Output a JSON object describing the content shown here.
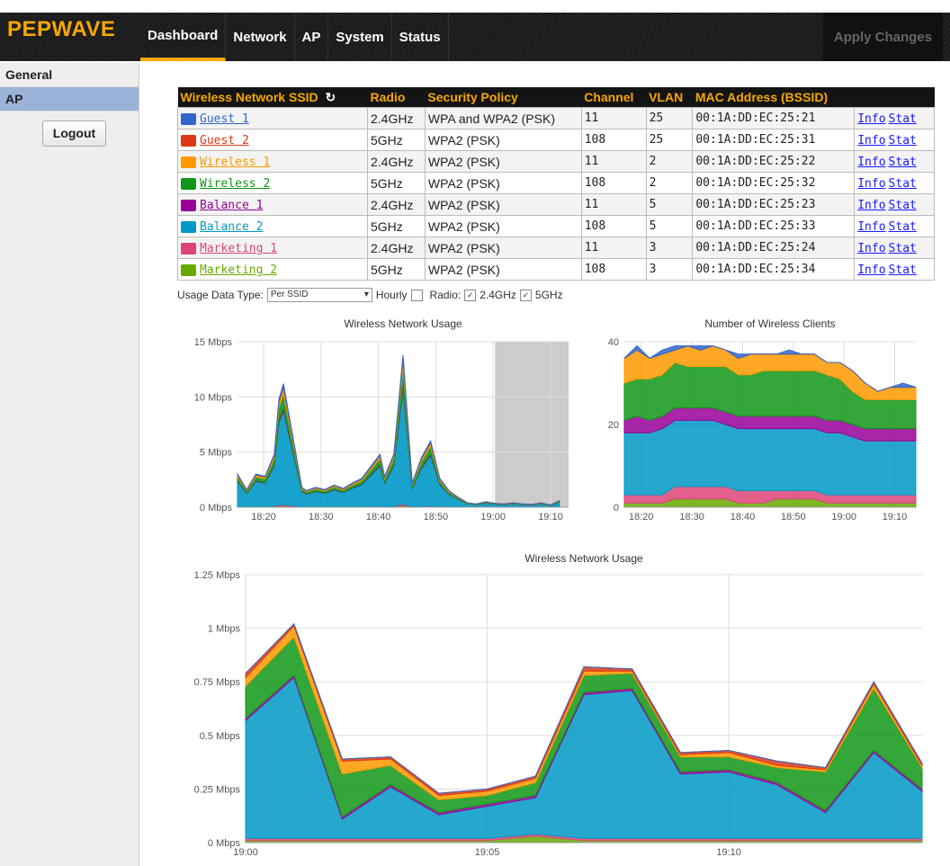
{
  "header": {
    "logo": "PEPWAVE",
    "tabs": [
      {
        "label": "Dashboard"
      },
      {
        "label": "Network"
      },
      {
        "label": "AP"
      },
      {
        "label": "System"
      },
      {
        "label": "Status"
      }
    ],
    "apply_label": "Apply Changes",
    "accent_color": "#f6a800"
  },
  "sidebar": {
    "items": [
      {
        "label": "General"
      },
      {
        "label": "AP"
      }
    ],
    "logout_label": "Logout"
  },
  "table": {
    "headers": {
      "ssid": "Wireless Network SSID",
      "radio": "Radio",
      "security": "Security Policy",
      "channel": "Channel",
      "vlan": "VLAN",
      "mac": "MAC Address (BSSID)"
    },
    "rows": [
      {
        "ssid": "Guest 1",
        "color": "#3366cc",
        "radio": "2.4GHz",
        "security": "WPA and WPA2 (PSK)",
        "channel": "11",
        "vlan": "25",
        "mac": "00:1A:DD:EC:25:21"
      },
      {
        "ssid": "Guest 2",
        "color": "#dc3912",
        "radio": "5GHz",
        "security": "WPA2 (PSK)",
        "channel": "108",
        "vlan": "25",
        "mac": "00:1A:DD:EC:25:31"
      },
      {
        "ssid": "Wireless 1",
        "color": "#ff9900",
        "radio": "2.4GHz",
        "security": "WPA2 (PSK)",
        "channel": "11",
        "vlan": "2",
        "mac": "00:1A:DD:EC:25:22"
      },
      {
        "ssid": "Wireless 2",
        "color": "#109618",
        "radio": "5GHz",
        "security": "WPA2 (PSK)",
        "channel": "108",
        "vlan": "2",
        "mac": "00:1A:DD:EC:25:32"
      },
      {
        "ssid": "Balance 1",
        "color": "#990099",
        "radio": "2.4GHz",
        "security": "WPA2 (PSK)",
        "channel": "11",
        "vlan": "5",
        "mac": "00:1A:DD:EC:25:23"
      },
      {
        "ssid": "Balance 2",
        "color": "#0099c6",
        "radio": "5GHz",
        "security": "WPA2 (PSK)",
        "channel": "108",
        "vlan": "5",
        "mac": "00:1A:DD:EC:25:33"
      },
      {
        "ssid": "Marketing 1",
        "color": "#dd4477",
        "radio": "2.4GHz",
        "security": "WPA2 (PSK)",
        "channel": "11",
        "vlan": "3",
        "mac": "00:1A:DD:EC:25:24"
      },
      {
        "ssid": "Marketing 2",
        "color": "#66aa00",
        "radio": "5GHz",
        "security": "WPA2 (PSK)",
        "channel": "108",
        "vlan": "3",
        "mac": "00:1A:DD:EC:25:34"
      }
    ],
    "info_label": "Info",
    "stat_label": "Stat"
  },
  "controls": {
    "usage_type_label": "Usage Data Type:",
    "usage_type_value": "Per SSID",
    "hourly_label": "Hourly",
    "radio_label": "Radio:",
    "radio_24_label": "2.4GHz",
    "radio_5_label": "5GHz"
  },
  "chart_data": [
    {
      "type": "area",
      "title": "Wireless Network Usage",
      "xlabel": "",
      "ylabel": "",
      "x_ticks": [
        "18:20",
        "18:30",
        "18:40",
        "18:50",
        "19:00",
        "19:10"
      ],
      "y_ticks": [
        "0 Mbps",
        "5 Mbps",
        "10 Mbps",
        "15 Mbps"
      ],
      "ylim": [
        0,
        15
      ],
      "x_minutes": [
        0,
        2,
        4,
        6,
        8,
        9,
        10,
        12,
        14,
        15,
        17,
        19,
        21,
        23,
        25,
        27,
        29,
        31,
        32,
        34,
        36,
        38,
        40,
        42,
        44,
        46,
        48,
        50,
        52,
        54,
        56,
        58,
        60,
        62,
        64,
        66,
        68,
        70
      ],
      "stack_total": [
        3,
        1.6,
        3,
        2.8,
        4.8,
        9.8,
        11.2,
        6.5,
        1.8,
        1.5,
        1.8,
        1.6,
        2,
        1.7,
        2.2,
        2.6,
        3.7,
        4.8,
        2.8,
        4.8,
        13.8,
        2.2,
        4.5,
        6,
        2.6,
        1.5,
        0.9,
        0.4,
        0.3,
        0.5,
        0.35,
        0.3,
        0.4,
        0.3,
        0.25,
        0.4,
        0.2,
        0.6
      ],
      "selected_range_minutes": [
        56,
        72
      ],
      "series_colors": [
        "#3366cc",
        "#dc3912",
        "#ff9900",
        "#109618",
        "#990099",
        "#0099c6",
        "#dd4477",
        "#66aa00"
      ]
    },
    {
      "type": "area",
      "title": "Number of Wireless Clients",
      "xlabel": "",
      "ylabel": "",
      "x_ticks": [
        "18:20",
        "18:30",
        "18:40",
        "18:50",
        "19:00",
        "19:10"
      ],
      "y_ticks": [
        "0",
        "20",
        "40"
      ],
      "ylim": [
        0,
        40
      ],
      "x_minutes": [
        0,
        3,
        6,
        9,
        12,
        15,
        18,
        21,
        24,
        27,
        30,
        33,
        36,
        39,
        42,
        45,
        48,
        51,
        54,
        57,
        60,
        63,
        66,
        69
      ],
      "series": [
        {
          "name": "Marketing 2",
          "color": "#66aa00",
          "values": [
            1,
            1,
            1,
            1,
            2,
            2,
            2,
            2,
            2,
            1,
            1,
            1,
            2,
            2,
            2,
            2,
            1,
            1,
            1,
            1,
            1,
            1,
            1,
            1
          ]
        },
        {
          "name": "Marketing 1",
          "color": "#dd4477",
          "values": [
            2,
            2,
            2,
            2,
            3,
            3,
            3,
            3,
            3,
            3,
            3,
            3,
            2,
            2,
            2,
            2,
            2,
            2,
            2,
            2,
            2,
            2,
            2,
            2
          ]
        },
        {
          "name": "Balance 2",
          "color": "#0099c6",
          "values": [
            15,
            15,
            15,
            16,
            16,
            16,
            16,
            16,
            15,
            15,
            15,
            15,
            15,
            15,
            15,
            15,
            15,
            15,
            14,
            13,
            13,
            13,
            13,
            13
          ]
        },
        {
          "name": "Balance 1",
          "color": "#990099",
          "values": [
            3,
            4,
            3,
            3,
            3,
            3,
            3,
            3,
            3,
            3,
            3,
            3,
            3,
            3,
            3,
            3,
            3,
            3,
            3,
            3,
            3,
            3,
            3,
            3
          ]
        },
        {
          "name": "Wireless 2",
          "color": "#109618",
          "values": [
            9,
            9,
            10,
            10,
            11,
            10,
            10,
            10,
            11,
            10,
            10,
            11,
            11,
            11,
            11,
            11,
            11,
            10,
            8,
            7,
            7,
            7,
            7,
            7
          ]
        },
        {
          "name": "Wireless 1",
          "color": "#ff9900",
          "values": [
            6,
            7,
            5,
            5,
            3,
            5,
            4,
            5,
            4,
            4,
            5,
            4,
            4,
            4,
            4,
            4,
            3,
            4,
            5,
            4,
            2,
            3,
            3,
            3
          ]
        },
        {
          "name": "Guest 2",
          "color": "#dc3912",
          "values": [
            0,
            0,
            0,
            0,
            0,
            0,
            0,
            0,
            0,
            0,
            0,
            0,
            0,
            0,
            0,
            0,
            0,
            0,
            0,
            0,
            0,
            0,
            0,
            0
          ]
        },
        {
          "name": "Guest 1",
          "color": "#3366cc",
          "values": [
            0,
            1,
            0,
            1,
            1,
            0,
            1,
            0,
            0,
            1,
            0,
            0,
            0,
            1,
            0,
            0,
            0,
            0,
            0,
            0,
            0,
            0,
            1,
            0
          ]
        }
      ]
    },
    {
      "type": "area",
      "title": "Wireless Network Usage",
      "xlabel": "",
      "ylabel": "",
      "x_ticks": [
        "19:00",
        "19:05",
        "19:10"
      ],
      "y_ticks": [
        "0 Mbps",
        "0.25 Mbps",
        "0.5 Mbps",
        "0.75 Mbps",
        "1 Mbps",
        "1.25 Mbps"
      ],
      "ylim": [
        0,
        1.25
      ],
      "x_minutes": [
        0,
        1,
        2,
        3,
        4,
        5,
        6,
        7,
        8,
        9,
        10,
        11,
        12,
        13,
        14
      ],
      "series": [
        {
          "name": "Marketing 2",
          "color": "#66aa00",
          "values": [
            0.01,
            0.01,
            0.01,
            0.01,
            0.01,
            0.01,
            0.03,
            0.01,
            0.01,
            0.01,
            0.01,
            0.01,
            0.01,
            0.01,
            0.01
          ]
        },
        {
          "name": "Marketing 1",
          "color": "#dd4477",
          "values": [
            0.01,
            0.01,
            0.01,
            0.01,
            0.01,
            0.01,
            0.01,
            0.01,
            0.01,
            0.01,
            0.01,
            0.01,
            0.01,
            0.01,
            0.01
          ]
        },
        {
          "name": "Balance 2",
          "color": "#0099c6",
          "values": [
            0.55,
            0.75,
            0.09,
            0.24,
            0.11,
            0.15,
            0.17,
            0.67,
            0.69,
            0.3,
            0.31,
            0.25,
            0.12,
            0.4,
            0.22
          ]
        },
        {
          "name": "Balance 1",
          "color": "#990099",
          "values": [
            0.01,
            0.01,
            0.01,
            0.01,
            0.01,
            0.01,
            0.01,
            0.01,
            0.01,
            0.01,
            0.01,
            0.01,
            0.01,
            0.01,
            0.01
          ]
        },
        {
          "name": "Wireless 2",
          "color": "#109618",
          "values": [
            0.15,
            0.18,
            0.2,
            0.09,
            0.06,
            0.04,
            0.06,
            0.08,
            0.07,
            0.07,
            0.06,
            0.07,
            0.18,
            0.29,
            0.1
          ]
        },
        {
          "name": "Wireless 1",
          "color": "#ff9900",
          "values": [
            0.04,
            0.05,
            0.06,
            0.03,
            0.02,
            0.02,
            0.02,
            0.02,
            0.01,
            0.01,
            0.02,
            0.01,
            0.01,
            0.02,
            0.01
          ]
        },
        {
          "name": "Guest 2",
          "color": "#dc3912",
          "values": [
            0.02,
            0.01,
            0.01,
            0.01,
            0.01,
            0.01,
            0.01,
            0.02,
            0.01,
            0.01,
            0.01,
            0.02,
            0.01,
            0.01,
            0.01
          ]
        },
        {
          "name": "Guest 1",
          "color": "#3366cc",
          "values": [
            0,
            0,
            0,
            0,
            0,
            0,
            0,
            0,
            0,
            0,
            0,
            0,
            0,
            0,
            0
          ]
        }
      ]
    }
  ]
}
